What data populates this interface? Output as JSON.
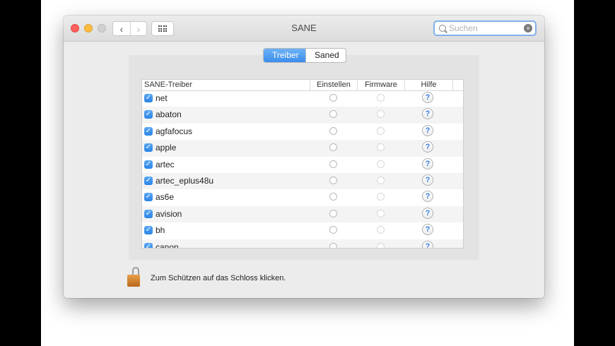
{
  "window": {
    "title": "SANE",
    "search_placeholder": "Suchen",
    "back_glyph": "‹",
    "forward_glyph": "›"
  },
  "tabs": [
    {
      "label": "Treiber",
      "active": true
    },
    {
      "label": "Saned",
      "active": false
    }
  ],
  "table": {
    "columns": [
      "SANE-Treiber",
      "Einstellen",
      "Firmware",
      "Hilfe"
    ],
    "rows": [
      {
        "name": "net",
        "checked": true
      },
      {
        "name": "abaton",
        "checked": true
      },
      {
        "name": "agfafocus",
        "checked": true
      },
      {
        "name": "apple",
        "checked": true
      },
      {
        "name": "artec",
        "checked": true
      },
      {
        "name": "artec_eplus48u",
        "checked": true
      },
      {
        "name": "as6e",
        "checked": true
      },
      {
        "name": "avision",
        "checked": true
      },
      {
        "name": "bh",
        "checked": true
      },
      {
        "name": "canon",
        "checked": true
      }
    ],
    "help_glyph": "?"
  },
  "lock": {
    "message": "Zum Schützen auf das Schloss klicken."
  },
  "colors": {
    "accent": "#3b8ded",
    "close": "#fc605c",
    "minimize": "#fdbc40"
  },
  "icons": [
    "close-icon",
    "minimize-icon",
    "zoom-icon",
    "back-icon",
    "forward-icon",
    "grid-icon",
    "search-icon",
    "clear-icon",
    "checkbox-icon",
    "radio-icon",
    "help-icon",
    "lock-icon"
  ]
}
